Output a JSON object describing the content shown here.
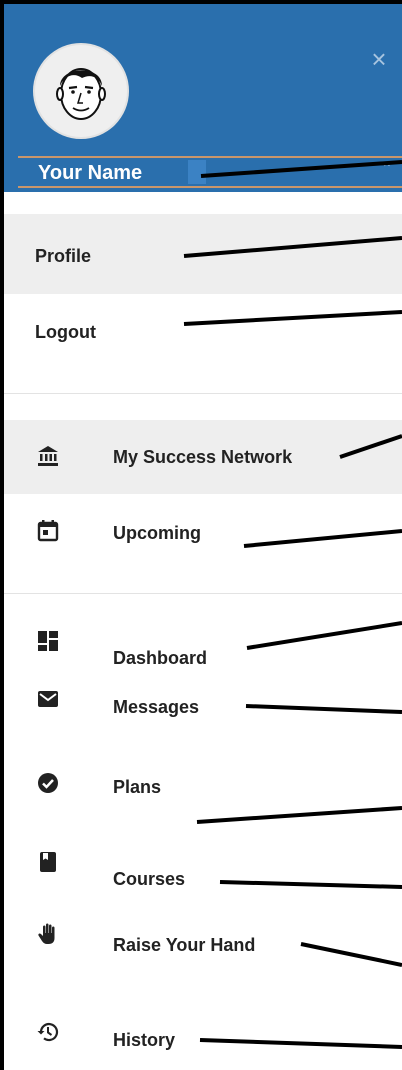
{
  "header": {
    "user_name": "Your Name",
    "close_glyph": "×",
    "expand_glyph": "⌃"
  },
  "account_menu": [
    {
      "id": "profile",
      "label": "Profile",
      "highlighted": true
    },
    {
      "id": "logout",
      "label": "Logout",
      "highlighted": false
    }
  ],
  "nav_groups": [
    [
      {
        "id": "my-success-network",
        "label": "My Success Network",
        "icon": "bank-icon",
        "highlighted": true
      },
      {
        "id": "upcoming",
        "label": "Upcoming",
        "icon": "calendar-icon",
        "highlighted": false
      }
    ],
    [
      {
        "id": "dashboard",
        "label": "Dashboard",
        "icon": "dashboard-icon"
      },
      {
        "id": "messages",
        "label": "Messages",
        "icon": "envelope-icon"
      },
      {
        "id": "plans",
        "label": "Plans",
        "icon": "check-circle-icon"
      },
      {
        "id": "courses",
        "label": "Courses",
        "icon": "book-icon"
      },
      {
        "id": "raise-your-hand",
        "label": "Raise Your Hand",
        "icon": "hand-icon"
      },
      {
        "id": "history",
        "label": "History",
        "icon": "history-icon"
      }
    ]
  ],
  "colors": {
    "header_bg": "#2a6fad",
    "highlight_bg": "#eeeeee",
    "name_border": "#c9966b",
    "text": "#222222"
  }
}
